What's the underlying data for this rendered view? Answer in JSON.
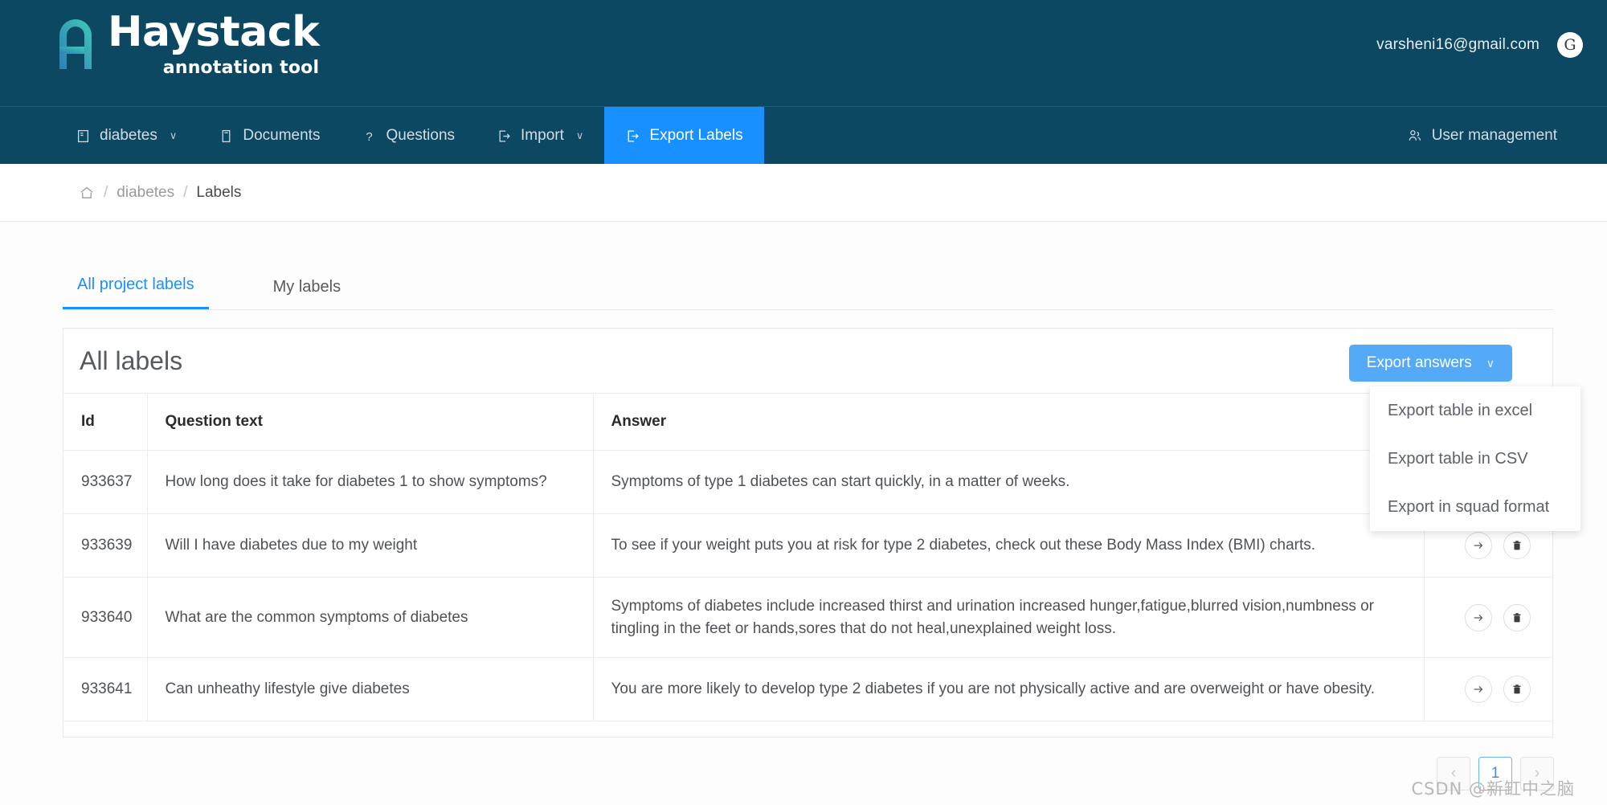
{
  "header": {
    "brand_name": "Haystack",
    "brand_sub": "annotation tool",
    "user_email": "varsheni16@gmail.com",
    "avatar_letter": "G",
    "bg_color": "#0d4863"
  },
  "navbar": {
    "items": [
      {
        "label": "diabetes",
        "icon": "book-icon",
        "caret": "∨",
        "active": false
      },
      {
        "label": "Documents",
        "icon": "document-icon",
        "caret": "",
        "active": false
      },
      {
        "label": "Questions",
        "icon": "question-mark-icon",
        "caret": "",
        "active": false
      },
      {
        "label": "Import",
        "icon": "import-icon",
        "caret": "∨",
        "active": false
      },
      {
        "label": "Export Labels",
        "icon": "export-icon",
        "caret": "",
        "active": true
      }
    ],
    "right_item": {
      "label": "User management",
      "icon": "users-icon"
    },
    "active_color": "#1890ff"
  },
  "breadcrumb": {
    "home_icon": "home-icon",
    "sep": "/",
    "project": "diabetes",
    "current": "Labels"
  },
  "tabs": [
    {
      "label": "All project labels",
      "active": true
    },
    {
      "label": "My labels",
      "active": false
    }
  ],
  "card": {
    "title": "All labels",
    "export_button": {
      "label": "Export answers",
      "caret": "∨",
      "color": "#55aaf7"
    }
  },
  "dropdown": {
    "open": true,
    "items": [
      "Export table in excel",
      "Export table in CSV",
      "Export in squad format"
    ]
  },
  "table": {
    "columns": [
      "Id",
      "Question text",
      "Answer",
      ""
    ],
    "rows": [
      {
        "id": "933637",
        "question": "How long does it take for diabetes 1 to show symptoms?",
        "answer": "Symptoms of type 1 diabetes can start quickly, in a matter of weeks."
      },
      {
        "id": "933639",
        "question": "Will I have diabetes due to my weight",
        "answer": "To see if your weight puts you at risk for type 2 diabetes, check out these Body Mass Index (BMI) charts."
      },
      {
        "id": "933640",
        "question": "What are the common symptoms of diabetes",
        "answer": "Symptoms of diabetes include increased thirst and urination increased hunger,fatigue,blurred vision,numbness or tingling in the feet or hands,sores that do not heal,unexplained weight loss."
      },
      {
        "id": "933641",
        "question": "Can unheathy lifestyle give diabetes",
        "answer": "You are more likely to develop type 2 diabetes if you are not physically active and are overweight or have obesity."
      }
    ],
    "row_actions": [
      {
        "name": "go-to-row-button",
        "icon": "arrow-right-icon"
      },
      {
        "name": "delete-row-button",
        "icon": "trash-icon"
      }
    ]
  },
  "pagination": {
    "prev": "‹",
    "next": "›",
    "pages": [
      "1"
    ],
    "current": "1"
  },
  "watermark": "CSDN @新缸中之脑"
}
